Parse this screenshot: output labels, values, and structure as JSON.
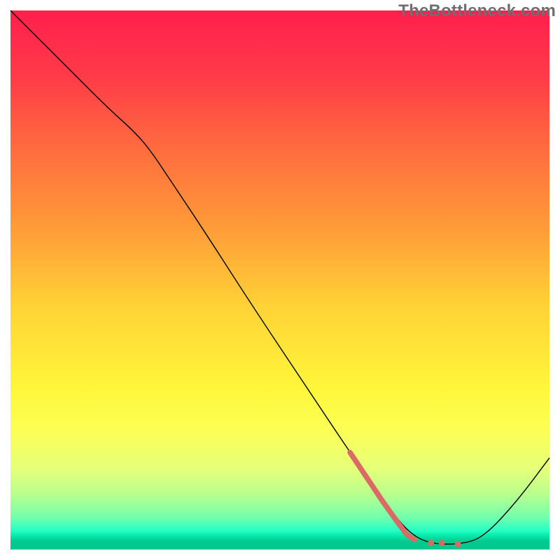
{
  "watermark": "TheBottleneck.com",
  "chart_data": {
    "type": "line",
    "title": "",
    "xlabel": "",
    "ylabel": "",
    "xlim": [
      0,
      100
    ],
    "ylim": [
      0,
      100
    ],
    "grid": false,
    "legend": false,
    "background": {
      "type": "vertical-gradient",
      "stops": [
        {
          "offset": 0.0,
          "color": "#ff1f4d"
        },
        {
          "offset": 0.12,
          "color": "#ff3a48"
        },
        {
          "offset": 0.25,
          "color": "#ff6a3f"
        },
        {
          "offset": 0.4,
          "color": "#ff9a38"
        },
        {
          "offset": 0.55,
          "color": "#ffd336"
        },
        {
          "offset": 0.7,
          "color": "#fff63a"
        },
        {
          "offset": 0.78,
          "color": "#fbff55"
        },
        {
          "offset": 0.85,
          "color": "#e6ff7a"
        },
        {
          "offset": 0.9,
          "color": "#b6ff8f"
        },
        {
          "offset": 0.94,
          "color": "#73ffad"
        },
        {
          "offset": 0.965,
          "color": "#25ffc4"
        },
        {
          "offset": 0.975,
          "color": "#06e7a8"
        },
        {
          "offset": 0.985,
          "color": "#04c98e"
        },
        {
          "offset": 1.0,
          "color": "#04c98e"
        }
      ]
    },
    "series": [
      {
        "name": "bottleneck-curve",
        "color": "#000000",
        "width": 1.4,
        "points": [
          {
            "x": 0.0,
            "y": 100.0
          },
          {
            "x": 6.0,
            "y": 94.0
          },
          {
            "x": 12.0,
            "y": 88.0
          },
          {
            "x": 18.0,
            "y": 82.0
          },
          {
            "x": 23.0,
            "y": 77.5
          },
          {
            "x": 26.0,
            "y": 74.0
          },
          {
            "x": 30.0,
            "y": 68.0
          },
          {
            "x": 36.0,
            "y": 59.0
          },
          {
            "x": 45.0,
            "y": 45.0
          },
          {
            "x": 55.0,
            "y": 30.0
          },
          {
            "x": 63.0,
            "y": 18.0
          },
          {
            "x": 70.0,
            "y": 8.0
          },
          {
            "x": 74.0,
            "y": 3.0
          },
          {
            "x": 78.0,
            "y": 1.0
          },
          {
            "x": 84.0,
            "y": 1.0
          },
          {
            "x": 88.0,
            "y": 2.5
          },
          {
            "x": 94.0,
            "y": 9.0
          },
          {
            "x": 100.0,
            "y": 17.0
          }
        ]
      },
      {
        "name": "highlight-segment",
        "color": "#d96a64",
        "width": 7.5,
        "linecap": "round",
        "points": [
          {
            "x": 63.0,
            "y": 18.0
          },
          {
            "x": 66.0,
            "y": 13.5
          },
          {
            "x": 69.0,
            "y": 9.0
          },
          {
            "x": 71.5,
            "y": 5.5
          },
          {
            "x": 73.5,
            "y": 2.8
          },
          {
            "x": 75.0,
            "y": 1.8
          }
        ]
      }
    ],
    "scatter": [
      {
        "name": "highlight-dots",
        "color": "#d96a64",
        "radius": 4.5,
        "points": [
          {
            "x": 78.0,
            "y": 1.2
          },
          {
            "x": 80.0,
            "y": 1.2
          },
          {
            "x": 83.0,
            "y": 1.0
          }
        ]
      }
    ]
  }
}
